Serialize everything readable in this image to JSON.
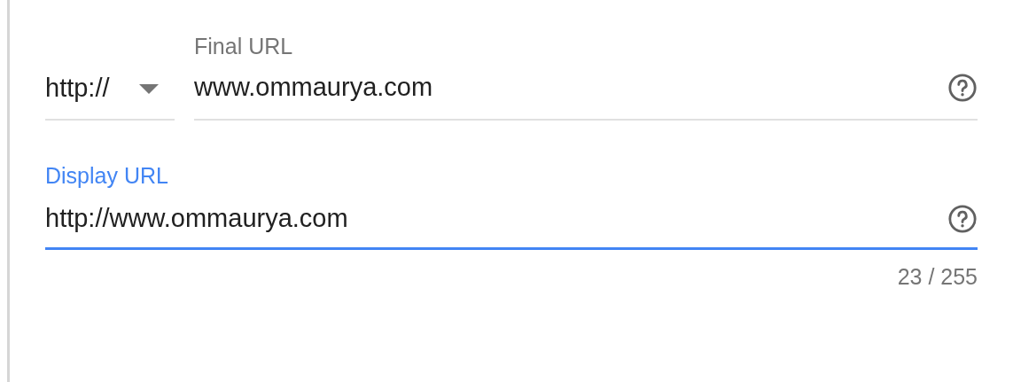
{
  "final_url": {
    "protocol": {
      "value": "http://"
    },
    "label": "Final URL",
    "value": "www.ommaurya.com",
    "focused": false
  },
  "display_url": {
    "label": "Display URL",
    "value": "http://www.ommaurya.com",
    "focused": true,
    "counter": "23 / 255"
  }
}
